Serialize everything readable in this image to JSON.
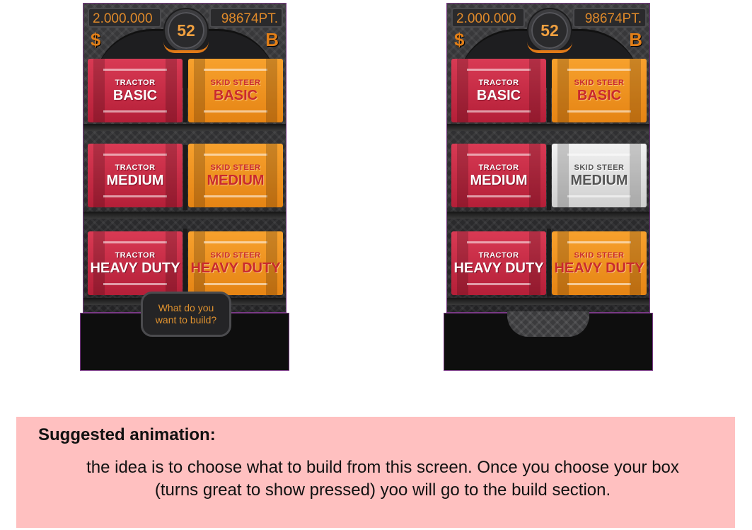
{
  "screens": [
    {
      "money": "2.000.000",
      "level": "52",
      "points": "98674PT.",
      "currency_left": "$",
      "currency_right": "B",
      "prompt": "What do you want to build?",
      "crates": [
        {
          "line1": "TRACTOR",
          "line2": "BASIC",
          "color": "red"
        },
        {
          "line1": "SKID STEER",
          "line2": "BASIC",
          "color": "orange"
        },
        {
          "line1": "TRACTOR",
          "line2": "MEDIUM",
          "color": "red"
        },
        {
          "line1": "SKID STEER",
          "line2": "MEDIUM",
          "color": "orange"
        },
        {
          "line1": "TRACTOR",
          "line2": "HEAVY DUTY",
          "color": "red"
        },
        {
          "line1": "SKID STEER",
          "line2": "HEAVY DUTY",
          "color": "orange"
        }
      ]
    },
    {
      "money": "2.000.000",
      "level": "52",
      "points": "98674PT.",
      "currency_left": "$",
      "currency_right": "B",
      "crates": [
        {
          "line1": "TRACTOR",
          "line2": "BASIC",
          "color": "red"
        },
        {
          "line1": "SKID STEER",
          "line2": "BASIC",
          "color": "orange"
        },
        {
          "line1": "TRACTOR",
          "line2": "MEDIUM",
          "color": "red"
        },
        {
          "line1": "SKID STEER",
          "line2": "MEDIUM",
          "color": "white"
        },
        {
          "line1": "TRACTOR",
          "line2": "HEAVY DUTY",
          "color": "red"
        },
        {
          "line1": "SKID STEER",
          "line2": "HEAVY DUTY",
          "color": "orange"
        }
      ]
    }
  ],
  "note": {
    "title": "Suggested animation:",
    "body_line1": "the idea is to choose what to build from this screen. Once you choose your box",
    "body_line2": "(turns great to show pressed) yoo will go to the build section."
  },
  "colors": {
    "accent_orange": "#e27f18",
    "crate_red": "#c92a44",
    "crate_orange": "#f0941f",
    "crate_pressed": "#e6e6e6",
    "note_background": "#ffc0c0",
    "frame_border": "#7a3a86"
  }
}
